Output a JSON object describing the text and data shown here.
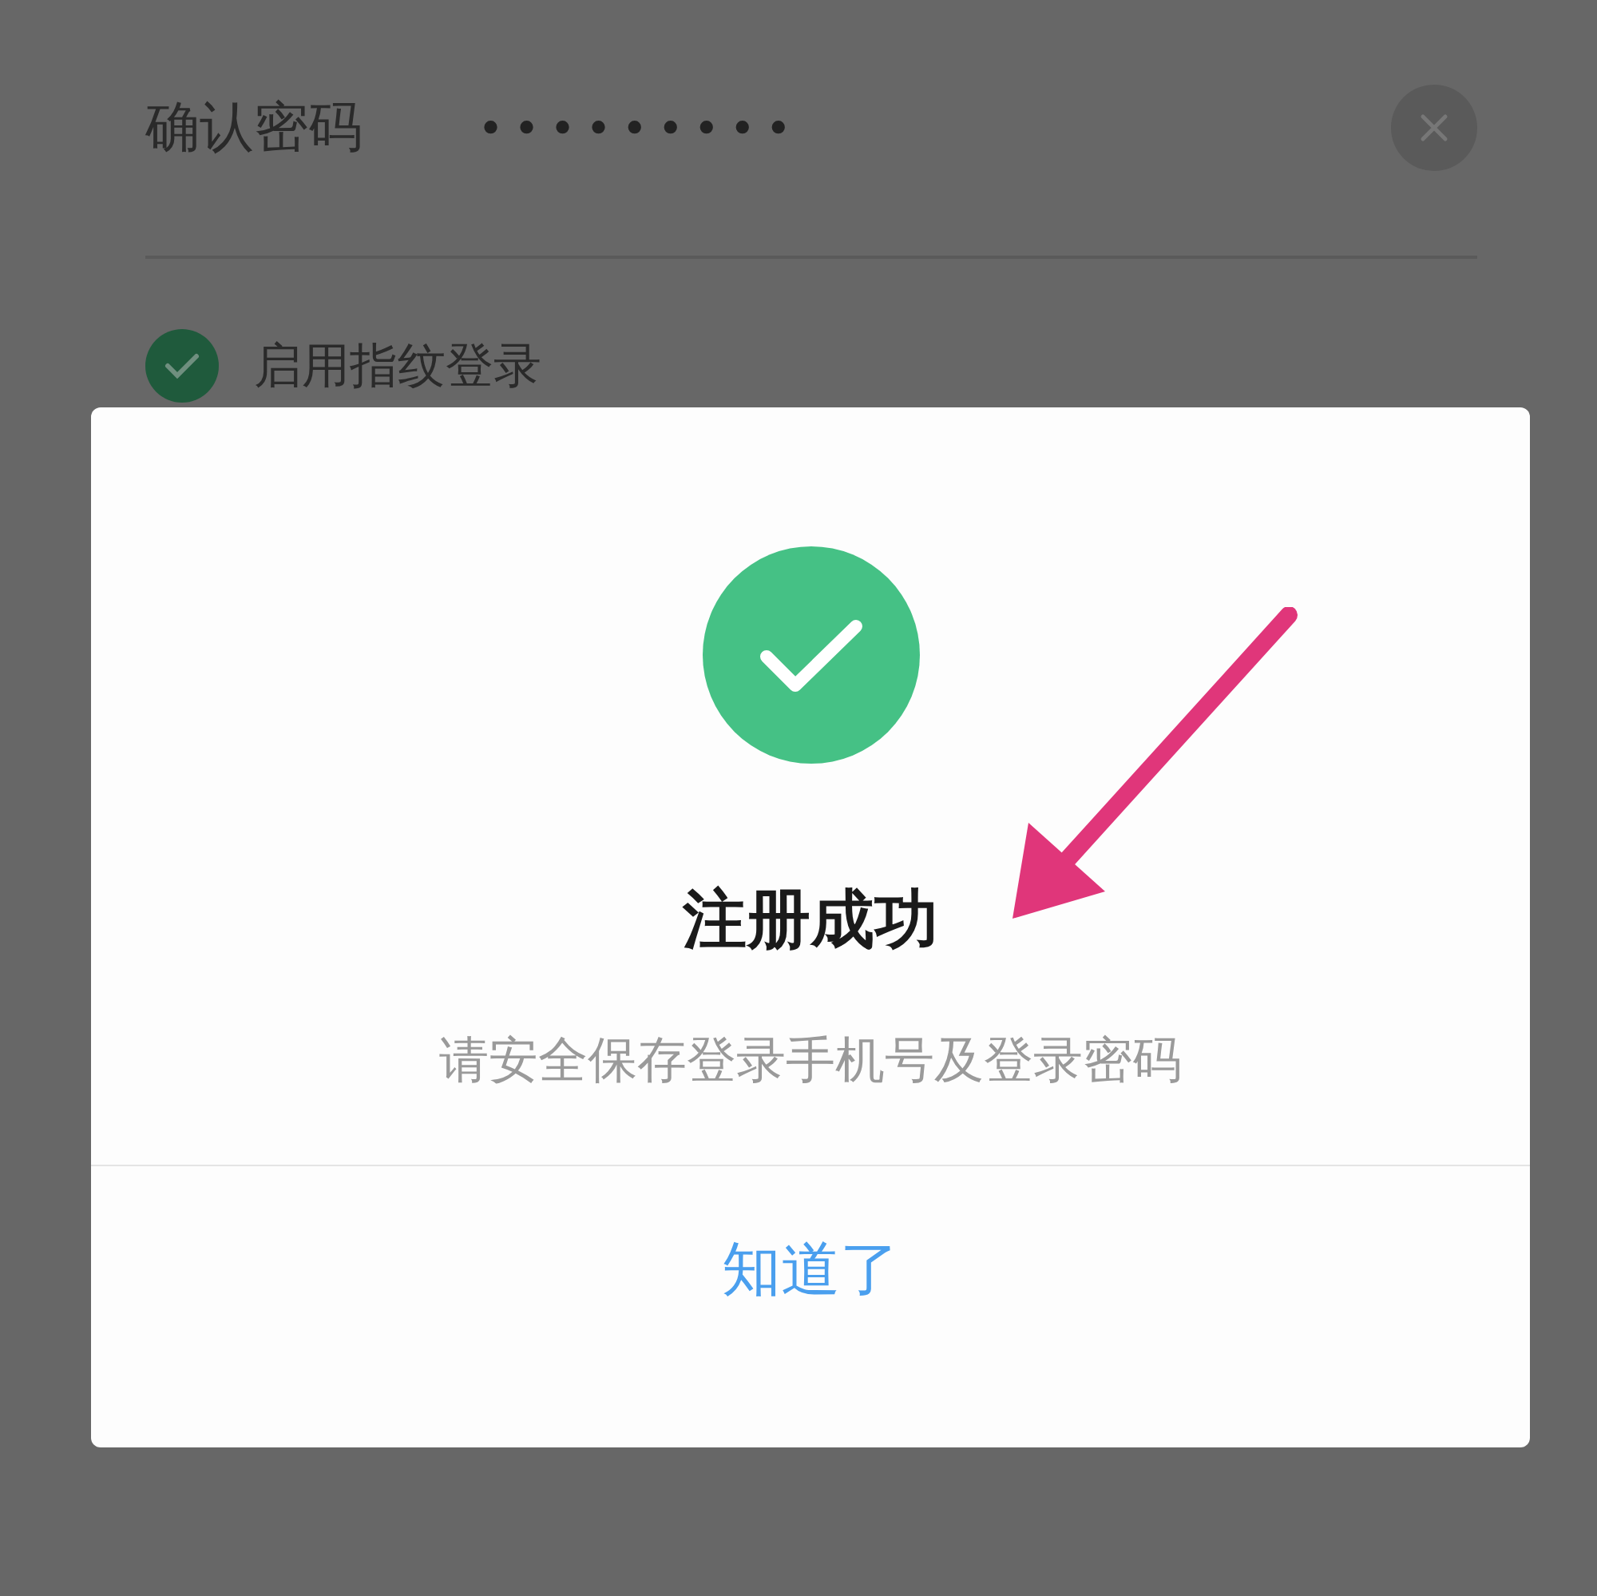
{
  "form": {
    "confirm_password": {
      "label": "确认密码",
      "value": "•••••••••"
    },
    "fingerprint": {
      "label": "启用指纹登录",
      "checked": true
    }
  },
  "dialog": {
    "title": "注册成功",
    "message": "请安全保存登录手机号及登录密码",
    "button": "知道了"
  }
}
